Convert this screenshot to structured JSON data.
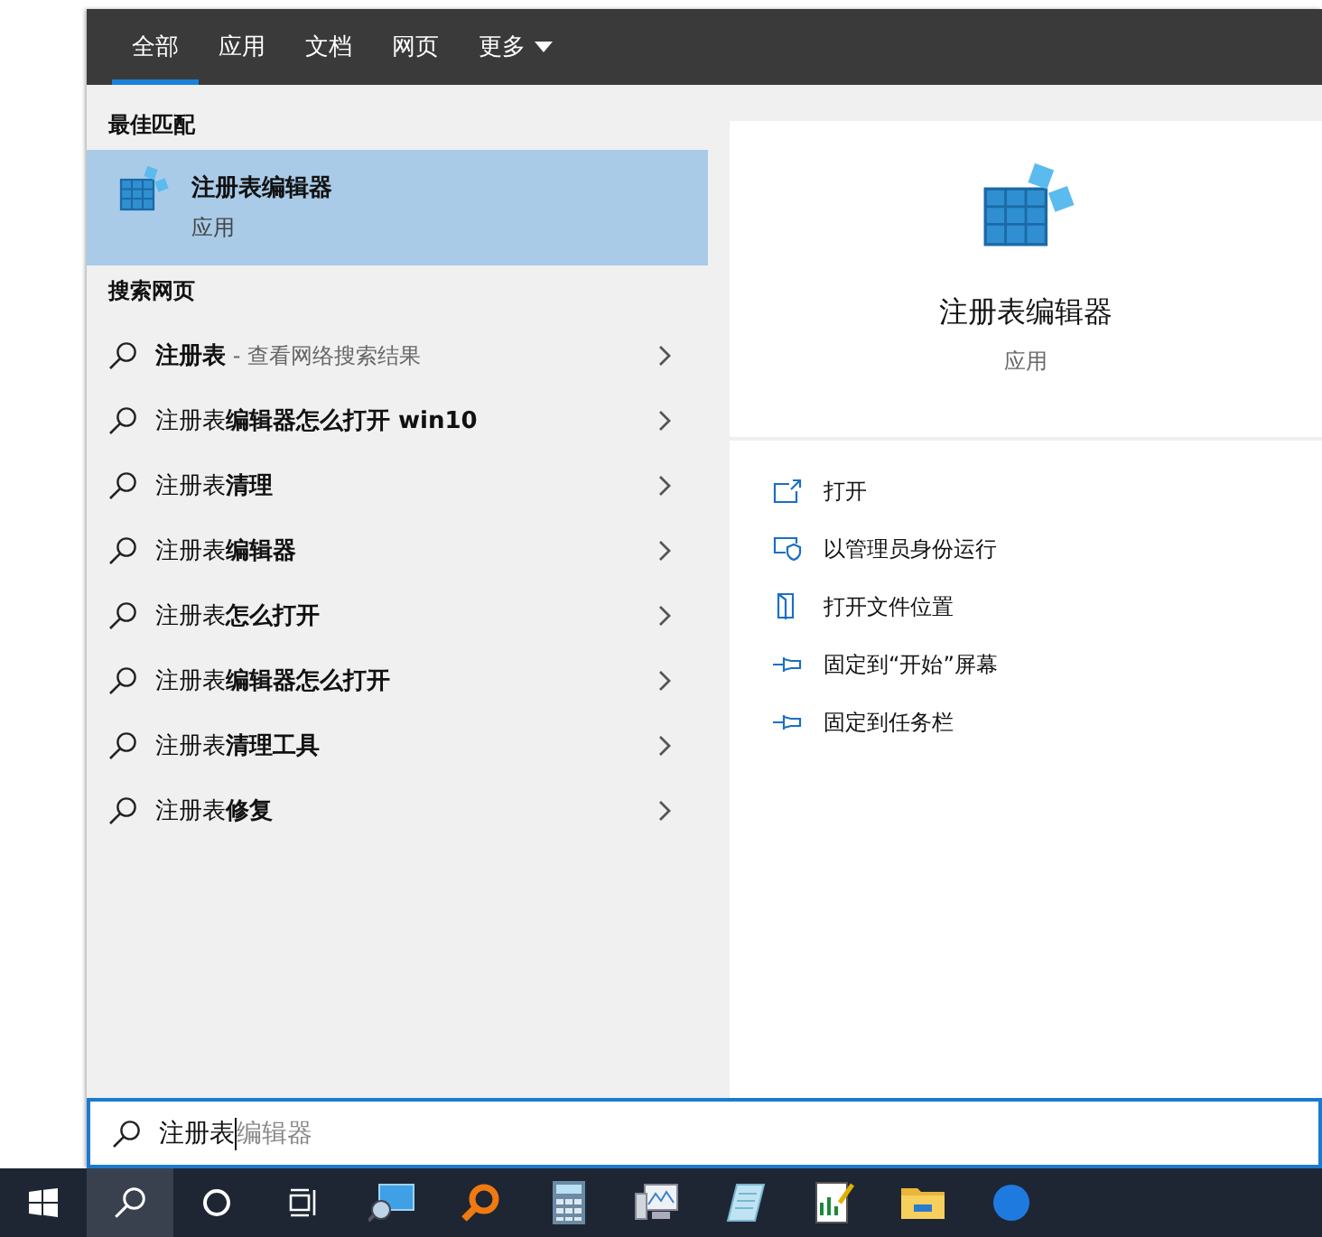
{
  "tabs": [
    {
      "label": "全部",
      "selected": true
    },
    {
      "label": "应用",
      "selected": false
    },
    {
      "label": "文档",
      "selected": false
    },
    {
      "label": "网页",
      "selected": false
    },
    {
      "label": "更多",
      "selected": false,
      "dropdown": true
    }
  ],
  "best_match": {
    "heading": "最佳匹配",
    "title": "注册表编辑器",
    "subtitle": "应用",
    "selected": true
  },
  "web": {
    "heading": "搜索网页",
    "items": [
      {
        "text": "**注册表**",
        "hint": " - 查看网络搜索结果"
      },
      {
        "text": "注册表**编辑器怎么打开 win10**"
      },
      {
        "text": "注册表**清理**"
      },
      {
        "text": "注册表**编辑器**"
      },
      {
        "text": "注册表**怎么打开**"
      },
      {
        "text": "注册表**编辑器怎么打开**"
      },
      {
        "text": "注册表**清理工具**"
      },
      {
        "text": "注册表**修复**"
      }
    ]
  },
  "preview": {
    "title": "注册表编辑器",
    "subtitle": "应用",
    "actions": [
      {
        "kind": "open",
        "label": "打开"
      },
      {
        "kind": "admin",
        "label": "以管理员身份运行"
      },
      {
        "kind": "location",
        "label": "打开文件位置"
      },
      {
        "kind": "pin",
        "label": "固定到“开始”屏幕"
      },
      {
        "kind": "pin",
        "label": "固定到任务栏"
      }
    ]
  },
  "search": {
    "value": "注册表",
    "suggestion": "编辑器"
  },
  "taskbar": [
    {
      "kind": "start",
      "selected": false
    },
    {
      "kind": "search",
      "selected": true
    },
    {
      "kind": "cortana",
      "selected": false
    },
    {
      "kind": "taskview",
      "selected": false
    },
    {
      "kind": "monitor",
      "selected": false
    },
    {
      "kind": "magnifier",
      "selected": false
    },
    {
      "kind": "calculator",
      "selected": false
    },
    {
      "kind": "computer",
      "selected": false
    },
    {
      "kind": "notepad",
      "selected": false
    },
    {
      "kind": "chartdoc",
      "selected": false
    },
    {
      "kind": "folder",
      "selected": false
    },
    {
      "kind": "bluecircle",
      "selected": false
    }
  ]
}
